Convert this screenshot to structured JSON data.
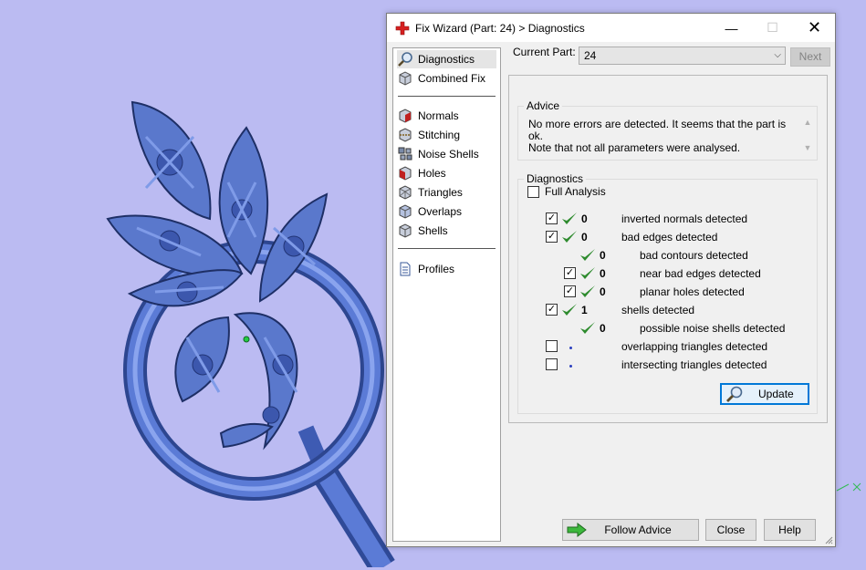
{
  "window": {
    "title": "Fix Wizard (Part: 24) > Diagnostics",
    "controls": {
      "minimize": "—",
      "maximize": "☐",
      "close": "✕"
    }
  },
  "nav": {
    "items": [
      {
        "label": "Diagnostics",
        "icon": "magnifier-icon",
        "selected": true
      },
      {
        "label": "Combined Fix",
        "icon": "cube-icon",
        "selected": false
      }
    ],
    "fix_items": [
      {
        "label": "Normals",
        "icon": "normals-cube-icon"
      },
      {
        "label": "Stitching",
        "icon": "stitching-cube-icon"
      },
      {
        "label": "Noise Shells",
        "icon": "noise-shells-icon"
      },
      {
        "label": "Holes",
        "icon": "holes-cube-icon"
      },
      {
        "label": "Triangles",
        "icon": "triangles-cube-icon"
      },
      {
        "label": "Overlaps",
        "icon": "overlaps-cube-icon"
      },
      {
        "label": "Shells",
        "icon": "shells-cube-icon"
      }
    ],
    "profiles": {
      "label": "Profiles",
      "icon": "document-icon"
    }
  },
  "current_part": {
    "label": "Current Part:",
    "value": "24",
    "next_label": "Next"
  },
  "advice": {
    "title": "Advice",
    "text_line1": "No more errors are detected. It seems that the part is ok.",
    "text_line2": "Note that not all parameters were analysed."
  },
  "diagnostics": {
    "title": "Diagnostics",
    "full_analysis": {
      "label": "Full Analysis",
      "checked": false
    },
    "rows": [
      {
        "checkbox": true,
        "checked": true,
        "status": "ok",
        "count": "0",
        "label": "inverted normals detected",
        "indent": 0
      },
      {
        "checkbox": true,
        "checked": true,
        "status": "ok",
        "count": "0",
        "label": "bad edges detected",
        "indent": 0
      },
      {
        "checkbox": false,
        "checked": false,
        "status": "ok",
        "count": "0",
        "label": "bad contours detected",
        "indent": 1
      },
      {
        "checkbox": true,
        "checked": true,
        "status": "ok",
        "count": "0",
        "label": "near bad edges detected",
        "indent": 1
      },
      {
        "checkbox": true,
        "checked": true,
        "status": "ok",
        "count": "0",
        "label": "planar holes detected",
        "indent": 1
      },
      {
        "checkbox": true,
        "checked": true,
        "status": "ok",
        "count": "1",
        "label": "shells detected",
        "indent": 0
      },
      {
        "checkbox": false,
        "checked": false,
        "status": "ok",
        "count": "0",
        "label": "possible noise shells detected",
        "indent": 1
      },
      {
        "checkbox": true,
        "checked": false,
        "status": "none",
        "count": "",
        "label": "overlapping triangles detected",
        "indent": 0
      },
      {
        "checkbox": true,
        "checked": false,
        "status": "none",
        "count": "",
        "label": "intersecting triangles detected",
        "indent": 0
      }
    ],
    "update_label": "Update"
  },
  "footer": {
    "follow_advice": "Follow Advice",
    "close": "Close",
    "help": "Help"
  },
  "colors": {
    "viewport_bg": "#bbbbf2",
    "model_blue": "#5a78cc",
    "check_green": "#2e8b2e",
    "accent": "#0078d7"
  }
}
